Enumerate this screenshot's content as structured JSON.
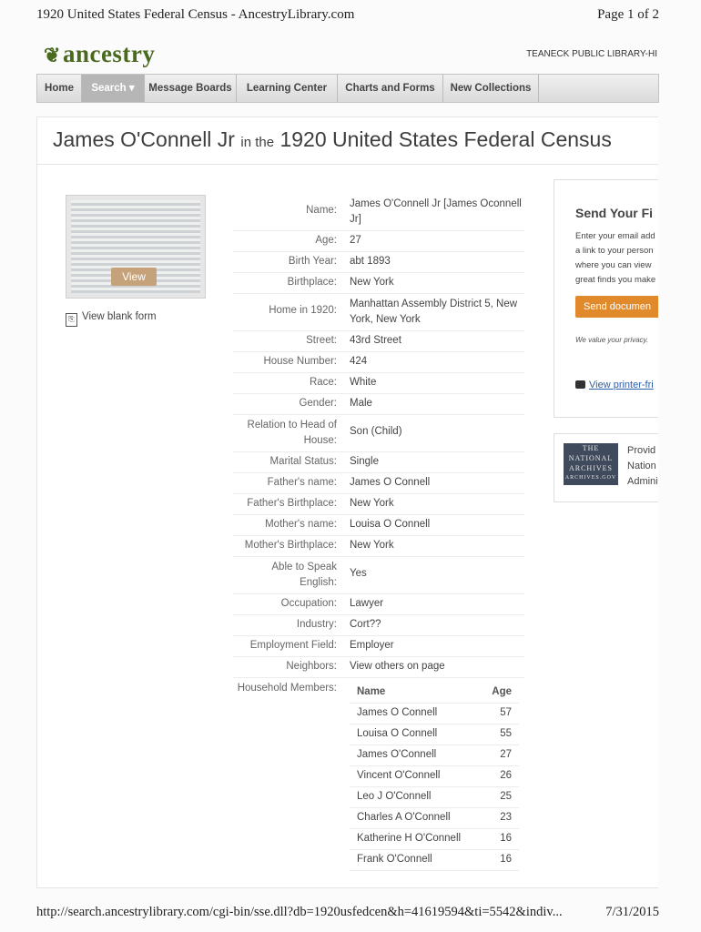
{
  "print_header": {
    "title": "1920 United States Federal Census - AncestryLibrary.com",
    "page": "Page 1 of 2"
  },
  "site": {
    "logo": "ancestry",
    "library": "TEANECK PUBLIC LIBRARY-HI"
  },
  "nav": [
    "Home",
    "Search ▾",
    "Message Boards",
    "Learning Center",
    "Charts and Forms",
    "New Collections"
  ],
  "record": {
    "name": "James O'Connell Jr",
    "in_the": "in the",
    "collection": "1920 United States Federal Census"
  },
  "image": {
    "view_label": "View",
    "blank_form": "View blank form"
  },
  "fields": [
    {
      "label": "Name:",
      "value": "James O'Connell Jr [James Oconnell Jr]"
    },
    {
      "label": "Age:",
      "value": "27"
    },
    {
      "label": "Birth Year:",
      "value": "abt 1893"
    },
    {
      "label": "Birthplace:",
      "value": "New York"
    },
    {
      "label": "Home in 1920:",
      "value": "Manhattan Assembly District 5, New York, New York"
    },
    {
      "label": "Street:",
      "value": "43rd Street"
    },
    {
      "label": "House Number:",
      "value": "424"
    },
    {
      "label": "Race:",
      "value": "White"
    },
    {
      "label": "Gender:",
      "value": "Male"
    },
    {
      "label": "Relation to Head of House:",
      "value": "Son (Child)"
    },
    {
      "label": "Marital Status:",
      "value": "Single"
    },
    {
      "label": "Father's name:",
      "value": "James O Connell"
    },
    {
      "label": "Father's Birthplace:",
      "value": "New York"
    },
    {
      "label": "Mother's name:",
      "value": "Louisa O Connell"
    },
    {
      "label": "Mother's Birthplace:",
      "value": "New York"
    },
    {
      "label": "Able to Speak English:",
      "value": "Yes"
    },
    {
      "label": "Occupation:",
      "value": "Lawyer"
    },
    {
      "label": "Industry:",
      "value": "Cort??"
    },
    {
      "label": "Employment Field:",
      "value": "Employer"
    },
    {
      "label": "Neighbors:",
      "value": "View others on page"
    }
  ],
  "household": {
    "label": "Household Members:",
    "col_name": "Name",
    "col_age": "Age",
    "members": [
      {
        "name": "James O Connell",
        "age": "57"
      },
      {
        "name": "Louisa O Connell",
        "age": "55"
      },
      {
        "name": "James O'Connell",
        "age": "27"
      },
      {
        "name": "Vincent O'Connell",
        "age": "26"
      },
      {
        "name": "Leo J O'Connell",
        "age": "25"
      },
      {
        "name": "Charles A O'Connell",
        "age": "23"
      },
      {
        "name": "Katherine H O'Connell",
        "age": "16"
      },
      {
        "name": "Frank O'Connell",
        "age": "16"
      }
    ]
  },
  "send_box": {
    "title": "Send Your Fi",
    "lines": [
      "Enter your email add",
      "a link to your person",
      "where you can view",
      "great finds you make"
    ],
    "button": "Send documen",
    "privacy": "We value your privacy.",
    "printer": "View printer-fri"
  },
  "nara": {
    "logo_lines": [
      "THE",
      "NATIONAL",
      "ARCHIVES",
      "ARCHIVES.GOV"
    ],
    "text_lines": [
      "Provid",
      "Nation",
      "Admini"
    ]
  },
  "footer": {
    "url": "http://search.ancestrylibrary.com/cgi-bin/sse.dll?db=1920usfedcen&h=41619594&ti=5542&indiv...",
    "date": "7/31/2015"
  }
}
